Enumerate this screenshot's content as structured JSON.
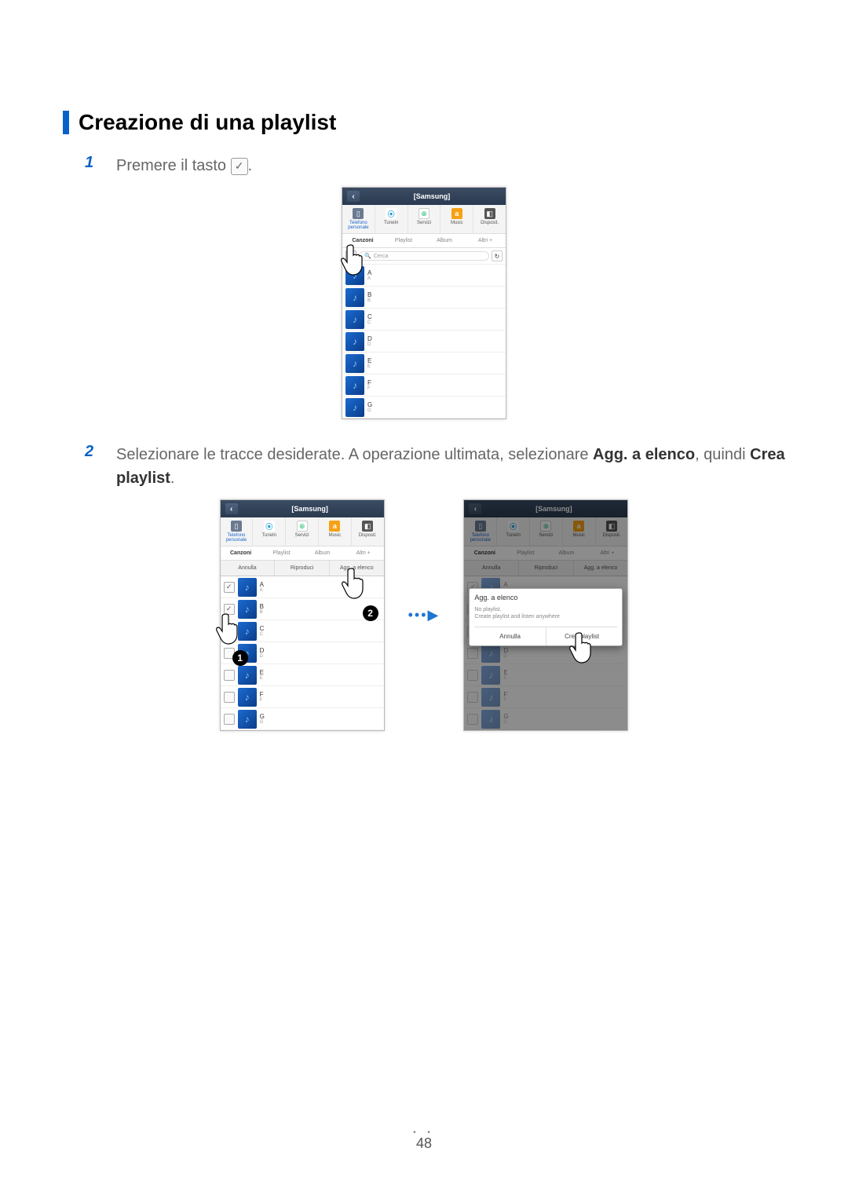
{
  "heading": "Creazione di una playlist",
  "step1": {
    "num": "1",
    "text": "Premere il tasto "
  },
  "step2": {
    "num": "2",
    "text_a": "Selezionare le tracce desiderate. A operazione ultimata, selezionare ",
    "bold_a": "Agg. a elenco",
    "text_b": ", quindi ",
    "bold_b": "Crea playlist",
    "text_c": "."
  },
  "phone": {
    "title": "[Samsung]",
    "sources": {
      "phone": "Telefono personale",
      "tunein": "TuneIn",
      "servizi": "Servizi",
      "music": "Music",
      "disposit": "Disposit."
    },
    "tabs": {
      "canzoni": "Canzoni",
      "playlist": "Playlist",
      "album": "Album",
      "altri": "Altri +"
    },
    "search": {
      "placeholder": "Cerca"
    },
    "actions": {
      "annulla": "Annulla",
      "riproduci": "Riproduci",
      "agg": "Agg. a elenco"
    },
    "rows": [
      {
        "t": "A",
        "s": "A"
      },
      {
        "t": "B",
        "s": "B"
      },
      {
        "t": "C",
        "s": "C"
      },
      {
        "t": "D",
        "s": "D"
      },
      {
        "t": "E",
        "s": "E"
      },
      {
        "t": "F",
        "s": "F"
      },
      {
        "t": "G",
        "s": "G"
      }
    ],
    "popup": {
      "title": "Agg. a elenco",
      "sub1": "No playlist.",
      "sub2": "Create playlist and listen anywhere",
      "cancel": "Annulla",
      "create": "Crea playlist"
    }
  },
  "pagenum": "48"
}
